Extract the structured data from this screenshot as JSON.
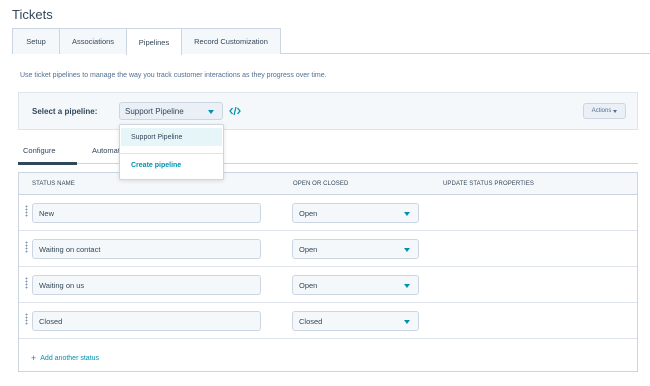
{
  "page": {
    "title": "Tickets"
  },
  "tabs": [
    "Setup",
    "Associations",
    "Pipelines",
    "Record Customization"
  ],
  "active_tab": "Pipelines",
  "intro_text": "Use ticket pipelines to manage the way you track customer interactions as they progress over time.",
  "pipeline": {
    "label": "Select a pipeline:",
    "selected": "Support Pipeline",
    "actions_label": "Actions"
  },
  "dropdown": {
    "options": [
      "Support Pipeline"
    ],
    "create_label": "Create pipeline"
  },
  "subtabs": {
    "configure": "Configure",
    "automate": "Automate"
  },
  "table": {
    "headers": {
      "status_name": "STATUS NAME",
      "open_or_closed": "OPEN OR CLOSED",
      "update_props": "UPDATE STATUS PROPERTIES"
    },
    "rows": [
      {
        "name": "New",
        "state": "Open"
      },
      {
        "name": "Waiting on contact",
        "state": "Open"
      },
      {
        "name": "Waiting on us",
        "state": "Open"
      },
      {
        "name": "Closed",
        "state": "Closed"
      }
    ],
    "add_label": "Add another status"
  },
  "colors": {
    "accent": "#0091ae",
    "text": "#33475b",
    "panel": "#f5f8fa",
    "border": "#cbd6e2"
  }
}
